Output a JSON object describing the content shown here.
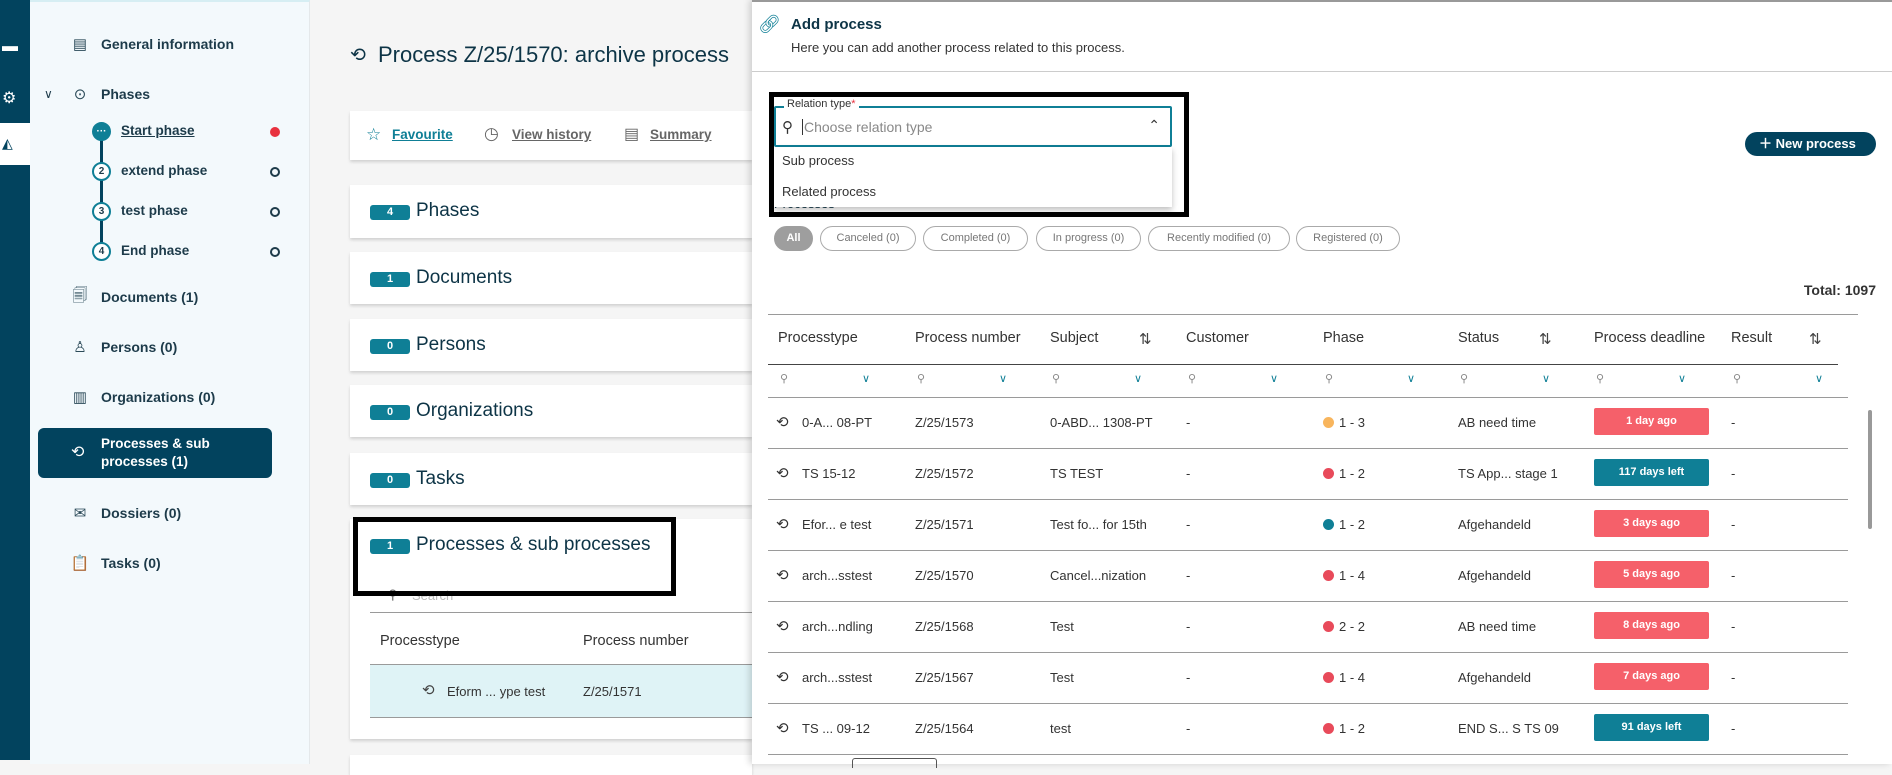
{
  "sidebar": {
    "general": "General information",
    "phases": "Phases",
    "phase_items": [
      {
        "num": "···",
        "label": "Start phase"
      },
      {
        "num": "2",
        "label": "extend phase"
      },
      {
        "num": "3",
        "label": "test phase"
      },
      {
        "num": "4",
        "label": "End phase"
      }
    ],
    "documents": "Documents (1)",
    "persons": "Persons (0)",
    "organizations": "Organizations (0)",
    "processes_line1": "Processes & sub",
    "processes_line2": "processes (1)",
    "dossiers": "Dossiers (0)",
    "tasks": "Tasks (0)"
  },
  "main": {
    "title": "Process Z/25/1570: archive process",
    "toolbar": {
      "favourite": "Favourite",
      "history": "View history",
      "summary": "Summary"
    },
    "cards": [
      {
        "count": "4",
        "title": "Phases"
      },
      {
        "count": "1",
        "title": "Documents"
      },
      {
        "count": "0",
        "title": "Persons"
      },
      {
        "count": "0",
        "title": "Organizations"
      },
      {
        "count": "0",
        "title": "Tasks"
      },
      {
        "count": "1",
        "title": "Processes & sub processes"
      }
    ],
    "sub_search_placeholder": "Search",
    "sub_table": {
      "headers": [
        "Processtype",
        "Process number"
      ],
      "row": [
        "Eform ... ype test",
        "Z/25/1571"
      ]
    }
  },
  "panel": {
    "title": "Add process",
    "subtitle": "Here you can add another process related to this process.",
    "relation_label": "Relation type",
    "required_mark": "*",
    "relation_placeholder": "Choose relation type",
    "options": [
      "Sub process",
      "Related process"
    ],
    "processes_label": "Processes",
    "new_process": "New process",
    "chips": [
      "All",
      "Canceled (0)",
      "Completed (0)",
      "In progress (0)",
      "Recently modified (0)",
      "Registered (0)"
    ],
    "total": "Total: 1097",
    "headers": [
      "Processtype",
      "Process number",
      "Subject",
      "Customer",
      "Phase",
      "Status",
      "Process deadline",
      "Result"
    ],
    "rows": [
      {
        "type": "0-A... 08-PT",
        "number": "Z/25/1573",
        "subject": "0-ABD... 1308-PT",
        "customer": "-",
        "phase": "1 - 3",
        "phase_color": "#f8b55d",
        "status": "AB need time",
        "deadline": "1 day ago",
        "deadline_color": "#f5606a",
        "result": "-"
      },
      {
        "type": "TS 15-12",
        "number": "Z/25/1572",
        "subject": "TS TEST",
        "customer": "-",
        "phase": "1 - 2",
        "phase_color": "#e84a5a",
        "status": "TS App... stage 1",
        "deadline": "117 days left",
        "deadline_color": "#0f7f96",
        "result": "-"
      },
      {
        "type": "Efor... e test",
        "number": "Z/25/1571",
        "subject": "Test fo... for 15th",
        "customer": "-",
        "phase": "1 - 2",
        "phase_color": "#0f7f96",
        "status": "Afgehandeld",
        "deadline": "3 days ago",
        "deadline_color": "#f5606a",
        "result": "-"
      },
      {
        "type": "arch...sstest",
        "number": "Z/25/1570",
        "subject": "Cancel...nization",
        "customer": "-",
        "phase": "1 - 4",
        "phase_color": "#e84a5a",
        "status": "Afgehandeld",
        "deadline": "5 days ago",
        "deadline_color": "#f5606a",
        "result": "-"
      },
      {
        "type": "arch...ndling",
        "number": "Z/25/1568",
        "subject": "Test",
        "customer": "-",
        "phase": "2 - 2",
        "phase_color": "#e84a5a",
        "status": "AB need time",
        "deadline": "8 days ago",
        "deadline_color": "#f5606a",
        "result": "-"
      },
      {
        "type": "arch...sstest",
        "number": "Z/25/1567",
        "subject": "Test",
        "customer": "-",
        "phase": "1 - 4",
        "phase_color": "#e84a5a",
        "status": "Afgehandeld",
        "deadline": "7 days ago",
        "deadline_color": "#f5606a",
        "result": "-"
      },
      {
        "type": "TS ... 09-12",
        "number": "Z/25/1564",
        "subject": "test",
        "customer": "-",
        "phase": "1 - 2",
        "phase_color": "#e84a5a",
        "status": "END S... S TS 09",
        "deadline": "91 days left",
        "deadline_color": "#0f7f96",
        "result": "-"
      }
    ]
  }
}
